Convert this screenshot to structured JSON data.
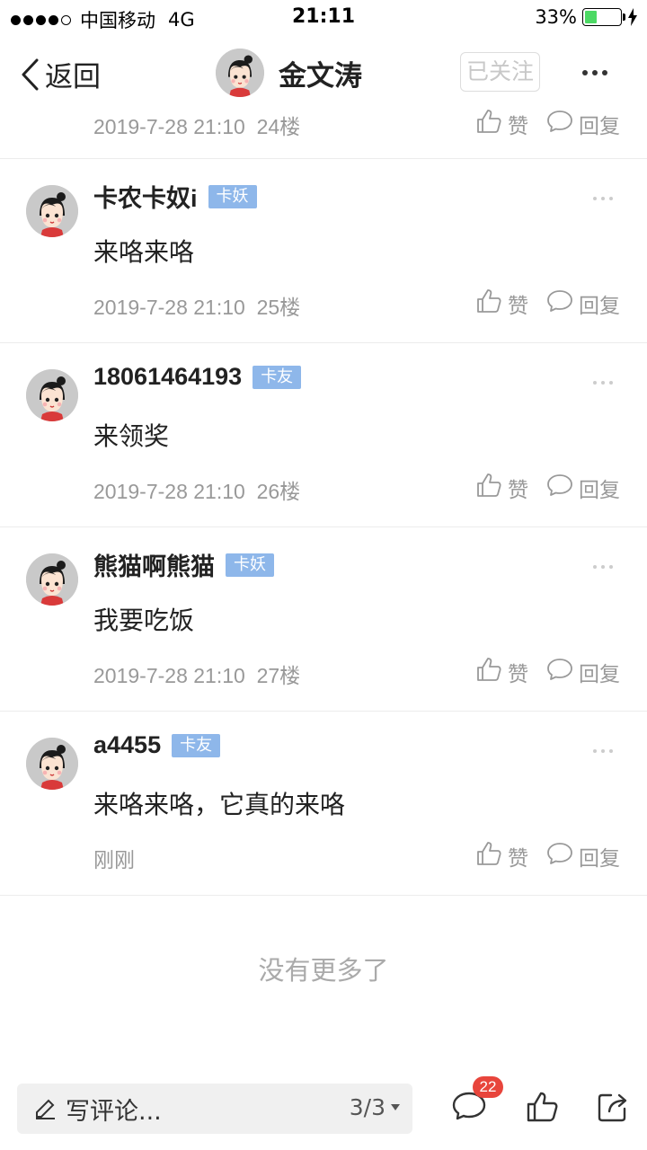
{
  "status": {
    "carrier": "中国移动",
    "network": "4G",
    "time": "21:11",
    "battery": "33%",
    "battery_level": 0.33,
    "battery_color": "#4cd964"
  },
  "nav": {
    "back_label": "返回",
    "title": "金文涛",
    "follow_label": "已关注"
  },
  "labels": {
    "like": "赞",
    "reply": "回复"
  },
  "partial": {
    "time": "2019-7-28 21:10",
    "floor": "24楼"
  },
  "comments": [
    {
      "username": "卡农卡奴i",
      "badge": "卡妖",
      "text": "来咯来咯",
      "time": "2019-7-28 21:10",
      "floor": "25楼"
    },
    {
      "username": "18061464193",
      "badge": "卡友",
      "text": "来领奖",
      "time": "2019-7-28 21:10",
      "floor": "26楼"
    },
    {
      "username": "熊猫啊熊猫",
      "badge": "卡妖",
      "text": "我要吃饭",
      "time": "2019-7-28 21:10",
      "floor": "27楼"
    },
    {
      "username": "a4455",
      "badge": "卡友",
      "text": "来咯来咯，它真的来咯",
      "time": "刚刚",
      "floor": ""
    }
  ],
  "footer_text": "没有更多了",
  "bottom": {
    "compose_placeholder": "写评论...",
    "pager": "3/3",
    "comment_count": "22"
  },
  "colors": {
    "badge": "#8eb7ea",
    "notification": "#e8453c"
  }
}
